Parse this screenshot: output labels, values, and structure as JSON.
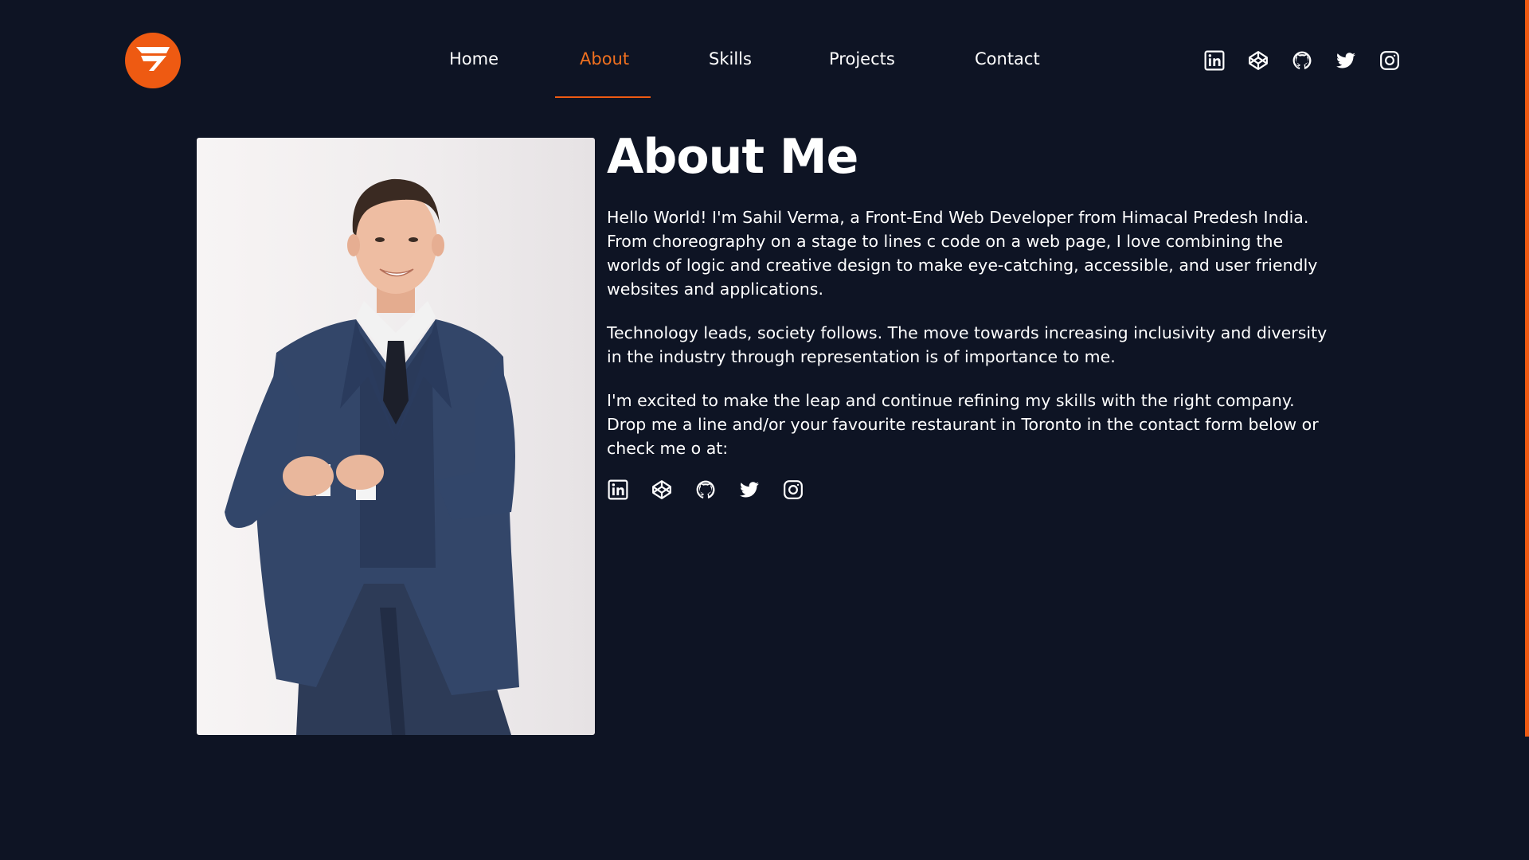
{
  "brand": {
    "accent_color": "#ee5a12",
    "background_color": "#0e1424",
    "logo_icon": "brand-logo-icon"
  },
  "nav": {
    "items": [
      {
        "label": "Home"
      },
      {
        "label": "About"
      },
      {
        "label": "Skills"
      },
      {
        "label": "Projects"
      },
      {
        "label": "Contact"
      }
    ],
    "active": "About"
  },
  "social": {
    "icons": [
      "linkedin-icon",
      "codepen-icon",
      "github-icon",
      "twitter-icon",
      "instagram-icon"
    ]
  },
  "about": {
    "title": "About Me",
    "paragraphs": [
      "Hello World! I'm Sahil Verma, a Front-End Web Developer from Himacal Predesh India. From choreography on a stage to lines c code on a web page, I love combining the worlds of logic and creative design to make eye-catching, accessible, and user friendly websites and applications.",
      "Technology leads, society follows. The move towards increasing inclusivity and diversity in the industry through representation is of importance to me.",
      "I'm excited to make the leap and continue refining my skills with the right company. Drop me a line and/or your favourite restaurant in Toronto in the contact form below or check me o at:"
    ]
  }
}
